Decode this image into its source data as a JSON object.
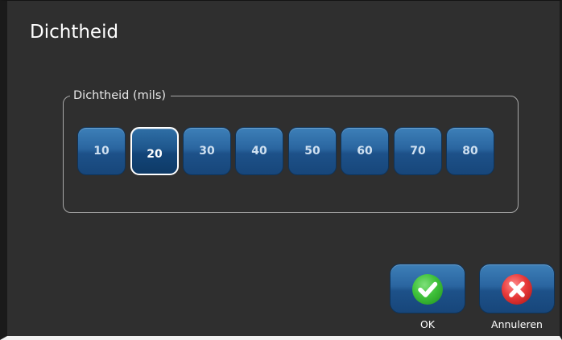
{
  "dialog": {
    "title": "Dichtheid"
  },
  "density_group": {
    "label": "Dichtheid (mils)",
    "options": [
      "10",
      "20",
      "30",
      "40",
      "50",
      "60",
      "70",
      "80"
    ],
    "selected": "20"
  },
  "actions": {
    "ok_label": "OK",
    "ok_icon": "checkmark-icon",
    "cancel_label": "Annuleren",
    "cancel_icon": "x-icon"
  },
  "colors": {
    "background": "#2f2f2f",
    "button_blue": "#2a65a0",
    "ok_green": "#3fc13a",
    "cancel_red": "#e83a3a"
  }
}
